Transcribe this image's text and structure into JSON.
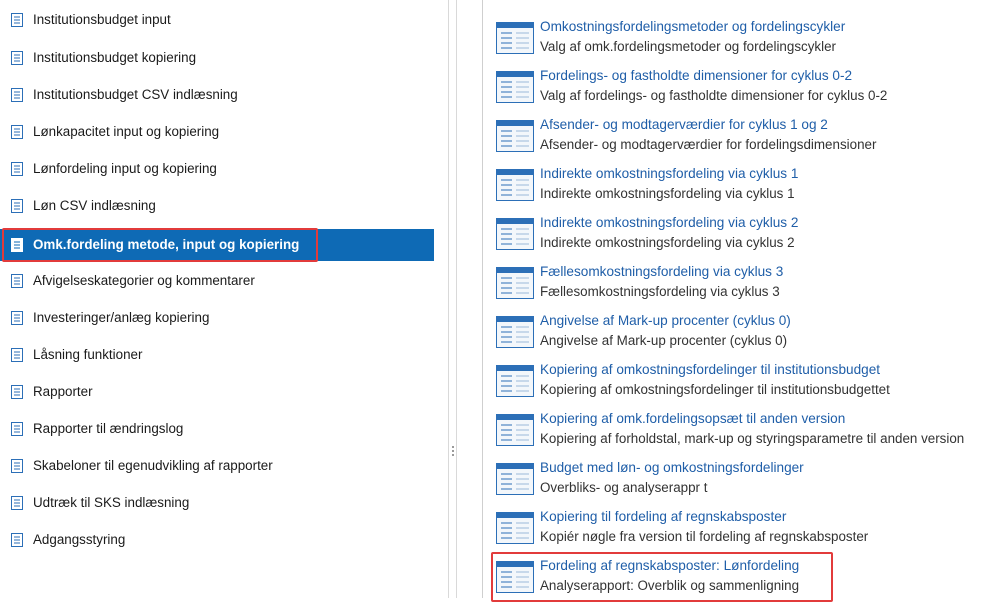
{
  "nav": {
    "items": [
      {
        "label": "Institutionsbudget input"
      },
      {
        "label": "Institutionsbudget kopiering"
      },
      {
        "label": "Institutionsbudget CSV indlæsning"
      },
      {
        "label": "Lønkapacitet input og kopiering"
      },
      {
        "label": "Lønfordeling input og kopiering"
      },
      {
        "label": "Løn CSV indlæsning"
      },
      {
        "label": "Omk.fordeling metode, input og kopiering",
        "selected": true
      },
      {
        "label": "Afvigelseskategorier og kommentarer"
      },
      {
        "label": "Investeringer/anlæg kopiering"
      },
      {
        "label": "Låsning funktioner"
      },
      {
        "label": "Rapporter"
      },
      {
        "label": "Rapporter til ændringslog"
      },
      {
        "label": "Skabeloner til egenudvikling af rapporter"
      },
      {
        "label": "Udtræk til SKS indlæsning"
      },
      {
        "label": "Adgangsstyring"
      }
    ]
  },
  "reports": {
    "items": [
      {
        "title": "Omkostningsfordelingsmetoder og fordelingscykler",
        "desc": "Valg af omk.fordelingsmetoder og fordelingscykler"
      },
      {
        "title": "Fordelings- og fastholdte dimensioner for cyklus 0-2",
        "desc": "Valg af fordelings- og fastholdte dimensioner for cyklus 0-2"
      },
      {
        "title": "Afsender- og modtagerværdier for cyklus 1 og 2",
        "desc": "Afsender- og modtagerværdier for fordelingsdimensioner"
      },
      {
        "title": "Indirekte omkostningsfordeling via cyklus 1",
        "desc": "Indirekte omkostningsfordeling via cyklus 1"
      },
      {
        "title": "Indirekte omkostningsfordeling via cyklus 2",
        "desc": "Indirekte omkostningsfordeling via cyklus 2"
      },
      {
        "title": "Fællesomkostningsfordeling via cyklus 3",
        "desc": "Fællesomkostningsfordeling via cyklus 3"
      },
      {
        "title": "Angivelse af Mark-up procenter (cyklus 0)",
        "desc": "Angivelse af Mark-up procenter (cyklus 0)"
      },
      {
        "title": "Kopiering af omkostningsfordelinger til institutionsbudget",
        "desc": "Kopiering af omkostningsfordelinger til institutionsbudgettet"
      },
      {
        "title": "Kopiering af omk.fordelingsopsæt til anden version",
        "desc": "Kopiering af forholdstal, mark-up og styringsparametre til anden version"
      },
      {
        "title": "Budget med løn- og omkostningsfordelinger",
        "desc": "Overbliks- og analyserappr t"
      },
      {
        "title": "Kopiering til fordeling af regnskabsposter",
        "desc": "Kopiér nøgle fra version til fordeling af regnskabsposter"
      },
      {
        "title": "Fordeling af regnskabsposter: Lønfordeling",
        "desc": "Analyserapport: Overblik og sammenligning",
        "highlighted": true
      }
    ]
  },
  "colors": {
    "selected_bg": "#0e6ab5",
    "link": "#1f5ea8",
    "highlight_outline": "#e23b3b"
  },
  "icons": {
    "nav_item": "document-icon",
    "report_tile": "report-icon"
  }
}
